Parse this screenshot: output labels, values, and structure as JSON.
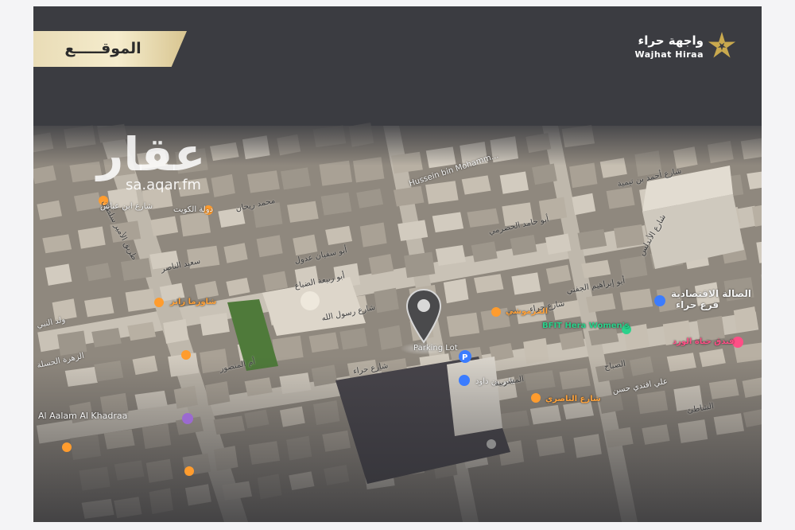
{
  "header": {
    "title": "الموقـــــع",
    "brand_name_ar": "واجهة حراء",
    "brand_name_en": "Wajhat Hiraa"
  },
  "watermark": {
    "main": "عقار",
    "sub": "sa.aqar.fm"
  },
  "colors": {
    "background": "#3a3b40",
    "banner_gold": "#efe3bf",
    "brand_gold": "#c9a94e",
    "pin": "#4a4a4c",
    "poi_orange": "#ff9c2e",
    "poi_blue": "#3b7cff",
    "poi_pink": "#ff4f86",
    "poi_green": "#2bd18b"
  },
  "map": {
    "pin_icon": "location-pin-icon",
    "labels": {
      "parking_lot": "Parking Lot",
      "hussein_mosque": "Hussein bin Mohamm...",
      "bfit": "BFIT Hera Women's",
      "al_aalam": "Al Aalam Al Khadraa",
      "hotel": "فندق حياة الورد",
      "hall": "الصالة الاقتصادية",
      "hall_branch": "فرع حراء",
      "shawarma": "شاورما رايز",
      "qarmoushi": "القرموشي",
      "hira_street": "شارع حراء",
      "hira_street_2": "شارع حراء",
      "hayer": "هاير بن داود",
      "ahmed_st": "شارع أحمد بن تيمية",
      "ibrahim": "أبو إبراهيم الجفني",
      "abu_hamid": "أبو حامد الحضرمي",
      "abu_sufyan": "أبو سفيان عدول",
      "abu_rabia": "أبو ربيعة الضباع",
      "saeed_nasser": "سعيد الناصر",
      "king_st": "طريق الأمير سلطان",
      "waleed": "ولد النبي",
      "zahra": "الزهرة الحسلة",
      "bin_abbas": "شارع ابن عباس",
      "dawlat": "دولة الكويت",
      "mohammed_rehan": "محمد ريحان",
      "abu_ubaidah": "أم المنصور",
      "ali_afandi": "علي افندي حسن",
      "sabah": "الصباح",
      "nasir": "شارع الناصري",
      "shaheen": "المشربية",
      "najam": "الشاطئ",
      "yousef": "شارع الأندلس",
      "rasool": "شارع رسول الله"
    }
  }
}
